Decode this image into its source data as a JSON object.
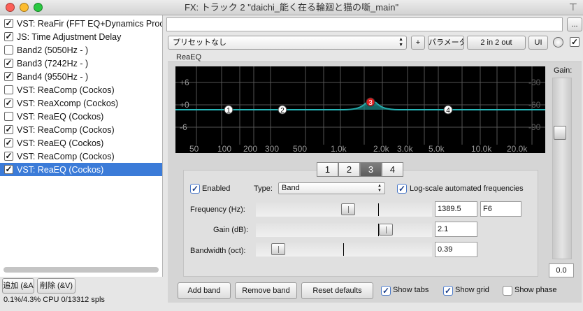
{
  "window": {
    "title": "FX: トラック 2 \"daichi_能く在る輪廻と猫の噺_main\"",
    "pin_glyph": "⊤"
  },
  "fx_chain": [
    {
      "label": "VST: ReaFir (FFT EQ+Dynamics Proc",
      "enabled": true,
      "selected": false
    },
    {
      "label": "JS: Time Adjustment Delay",
      "enabled": true,
      "selected": false
    },
    {
      "label": "Band2 (5050Hz - )",
      "enabled": false,
      "selected": false
    },
    {
      "label": "Band3 (7242Hz - )",
      "enabled": true,
      "selected": false
    },
    {
      "label": "Band4 (9550Hz - )",
      "enabled": true,
      "selected": false
    },
    {
      "label": "VST: ReaComp (Cockos)",
      "enabled": false,
      "selected": false
    },
    {
      "label": "VST: ReaXcomp (Cockos)",
      "enabled": true,
      "selected": false
    },
    {
      "label": "VST: ReaEQ (Cockos)",
      "enabled": false,
      "selected": false
    },
    {
      "label": "VST: ReaComp (Cockos)",
      "enabled": true,
      "selected": false
    },
    {
      "label": "VST: ReaEQ (Cockos)",
      "enabled": true,
      "selected": false
    },
    {
      "label": "VST: ReaComp (Cockos)",
      "enabled": true,
      "selected": false
    },
    {
      "label": "VST: ReaEQ (Cockos)",
      "enabled": true,
      "selected": true
    }
  ],
  "chain_buttons": {
    "add": "追加 (&A",
    "delete": "削除 (&V)"
  },
  "cpu_status": "0.1%/4.3% CPU 0/13312 spls",
  "top_bar": {
    "dots": "...",
    "preset": "プリセットなし",
    "plus": "+",
    "params": "パラメータ",
    "io": "2 in 2 out",
    "ui": "UI"
  },
  "plugin": {
    "name": "ReaEQ",
    "gain_label": "Gain:",
    "gain_value": "0.0",
    "graph": {
      "db_labels": [
        "+6",
        "+0",
        "-6"
      ],
      "phase_labels": [
        "-30",
        "-60",
        "-90"
      ],
      "freq_labels": [
        "50",
        "100",
        "200",
        "300",
        "500",
        "1.0k",
        "2.0k",
        "3.0k",
        "5.0k",
        "10.0k",
        "20.0k"
      ],
      "band_nodes": [
        "1",
        "2",
        "3",
        "4"
      ],
      "curve_color": "#27b7b9",
      "active_node_color": "#e02020"
    },
    "tabs": [
      "1",
      "2",
      "3",
      "4"
    ],
    "selected_tab": "3",
    "enabled_label": "Enabled",
    "type_label": "Type:",
    "type_value": "Band",
    "log_scale_label": "Log-scale automated frequencies",
    "frequency_label": "Frequency (Hz):",
    "frequency_value": "1389.5",
    "frequency_note": "F6",
    "gain_db_label": "Gain (dB):",
    "gain_db_value": "2.1",
    "bandwidth_label": "Bandwidth (oct):",
    "bandwidth_value": "0.39",
    "add_band": "Add band",
    "remove_band": "Remove band",
    "reset_defaults": "Reset defaults",
    "show_tabs": "Show tabs",
    "show_grid": "Show grid",
    "show_phase": "Show phase"
  }
}
